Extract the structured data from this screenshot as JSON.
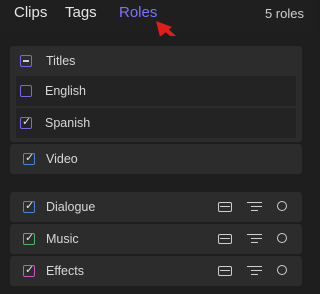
{
  "tabs": [
    {
      "label": "Clips",
      "active": false
    },
    {
      "label": "Tags",
      "active": false
    },
    {
      "label": "Roles",
      "active": true
    }
  ],
  "count_label": "5 roles",
  "titles_group": {
    "label": "Titles",
    "state": "mixed",
    "color": "#7e63e6",
    "subroles": [
      {
        "label": "English",
        "checked": false
      },
      {
        "label": "Spanish",
        "checked": true
      }
    ]
  },
  "video_role": {
    "label": "Video",
    "checked": true,
    "color": "#4a86d8"
  },
  "audio_roles": [
    {
      "label": "Dialogue",
      "checked": true,
      "color": "#4a86d8"
    },
    {
      "label": "Music",
      "checked": true,
      "color": "#4fb46a"
    },
    {
      "label": "Effects",
      "checked": true,
      "color": "#c858c0"
    }
  ],
  "row_icons": [
    "focus-icon",
    "lanes-icon",
    "circle-icon"
  ],
  "annotation": {
    "arrow_color": "#e21b1b"
  }
}
